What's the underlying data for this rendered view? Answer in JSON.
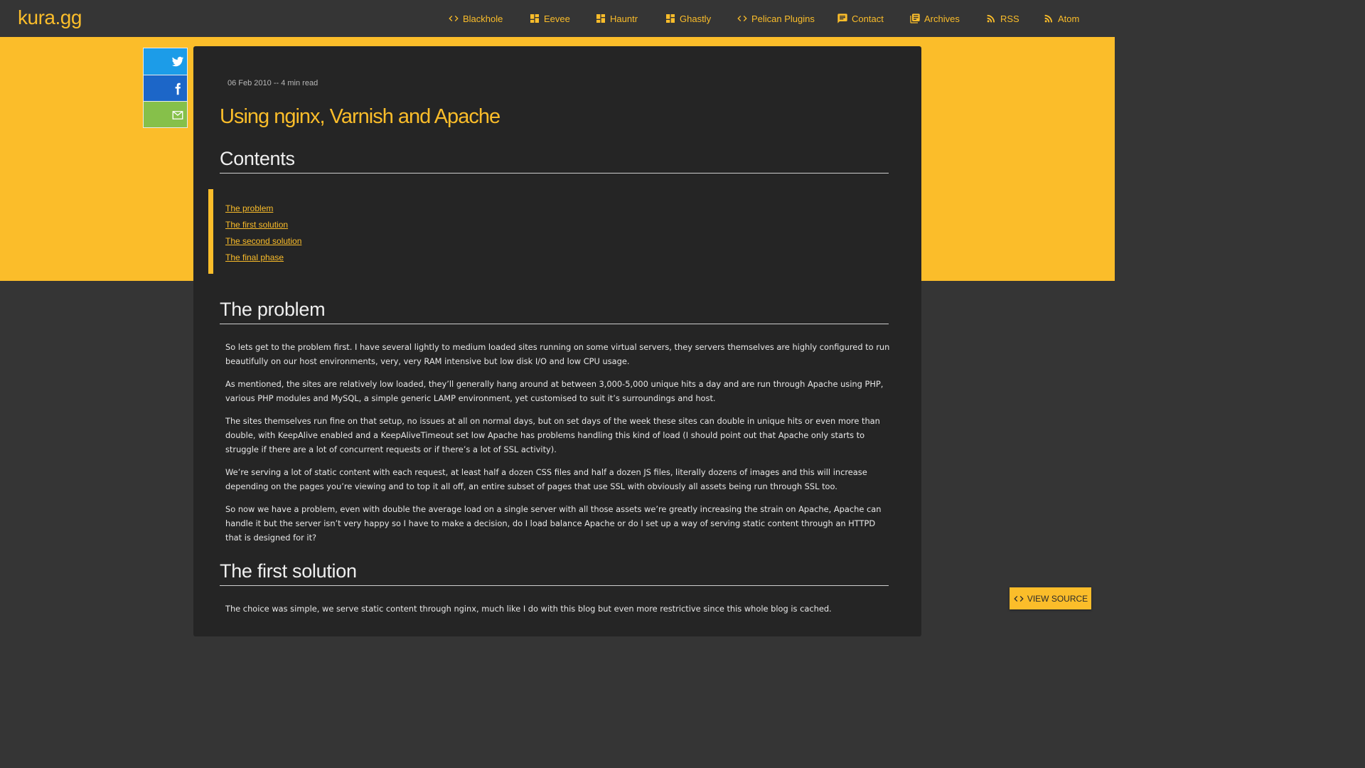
{
  "header": {
    "brand": "kura.gg",
    "nav": [
      {
        "label": "Blackhole",
        "icon": "code-icon"
      },
      {
        "label": "Eevee",
        "icon": "dashboard-icon"
      },
      {
        "label": "Hauntr",
        "icon": "dashboard-icon"
      },
      {
        "label": "Ghastly",
        "icon": "dashboard-icon"
      },
      {
        "label": "Pelican Plugins",
        "icon": "code-icon"
      },
      {
        "label": "Contact",
        "icon": "message-icon"
      },
      {
        "label": "Archives",
        "icon": "library-icon"
      },
      {
        "label": "RSS",
        "icon": "rss-icon"
      },
      {
        "label": "Atom",
        "icon": "rss-icon"
      }
    ]
  },
  "share": {
    "twitter_icon": "twitter-icon",
    "facebook_icon": "facebook-icon",
    "email_icon": "email-icon"
  },
  "article": {
    "meta": "06 Feb 2010 -- 4 min read",
    "title": "Using nginx, Varnish and Apache",
    "contents_heading": "Contents",
    "toc": [
      "The problem",
      "The first solution",
      "The second solution",
      "The final phase"
    ],
    "problem_heading": "The problem",
    "problem_paragraphs": [
      "So lets get to the problem first. I have several lightly to medium loaded sites running on some virtual servers, they servers themselves are highly configured to run beautifully on our host environments, very, very RAM intensive but low disk I/O and low CPU usage.",
      "As mentioned, the sites are relatively low loaded, they’ll generally hang around at between 3,000-5,000 unique hits a day and are run through Apache using PHP, various PHP modules and MySQL, a simple generic LAMP environment, yet customised to suit it’s surroundings and host.",
      "The sites themselves run fine on that setup, no issues at all on normal days, but on set days of the week these sites can double in unique hits or even more than double, with KeepAlive enabled and a KeepAliveTimeout set low Apache has problems handling this kind of load (I should point out that Apache only starts to struggle if there are a lot of concurrent requests or if there’s a lot of SSL activity).",
      "We’re serving a lot of static content with each request, at least half a dozen CSS files and half a dozen JS files, literally dozens of images and this will increase depending on the pages you’re viewing and to top it all off, an entire subset of pages that use SSL with obviously all assets being run through SSL too.",
      "So now we have a problem, even with double the average load on a single server with all those assets we’re greatly increasing the strain on Apache, Apache can handle it but the server isn’t very happy so I have to make a decision, do I load balance Apache or do I set up a way of serving static content through an HTTPD that is designed for it?"
    ],
    "first_solution_heading": "The first solution",
    "first_solution_paragraph": "The choice was simple, we serve static content through nginx, much like I do with this blog but even more restrictive since this whole blog is cached."
  },
  "view_source": {
    "label": "VIEW SOURCE",
    "icon": "code-icon"
  },
  "colors": {
    "accent": "#fbbd2a",
    "background": "#353535",
    "article": "#252525"
  }
}
